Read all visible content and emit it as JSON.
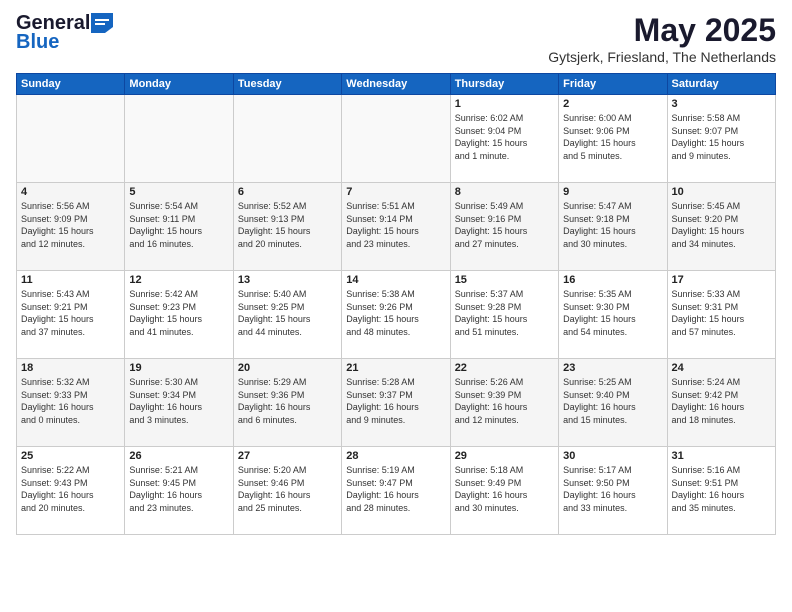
{
  "header": {
    "logo_general": "General",
    "logo_blue": "Blue",
    "month_title": "May 2025",
    "location": "Gytsjerk, Friesland, The Netherlands"
  },
  "days_of_week": [
    "Sunday",
    "Monday",
    "Tuesday",
    "Wednesday",
    "Thursday",
    "Friday",
    "Saturday"
  ],
  "weeks": [
    [
      {
        "day": "",
        "info": ""
      },
      {
        "day": "",
        "info": ""
      },
      {
        "day": "",
        "info": ""
      },
      {
        "day": "",
        "info": ""
      },
      {
        "day": "1",
        "info": "Sunrise: 6:02 AM\nSunset: 9:04 PM\nDaylight: 15 hours\nand 1 minute."
      },
      {
        "day": "2",
        "info": "Sunrise: 6:00 AM\nSunset: 9:06 PM\nDaylight: 15 hours\nand 5 minutes."
      },
      {
        "day": "3",
        "info": "Sunrise: 5:58 AM\nSunset: 9:07 PM\nDaylight: 15 hours\nand 9 minutes."
      }
    ],
    [
      {
        "day": "4",
        "info": "Sunrise: 5:56 AM\nSunset: 9:09 PM\nDaylight: 15 hours\nand 12 minutes."
      },
      {
        "day": "5",
        "info": "Sunrise: 5:54 AM\nSunset: 9:11 PM\nDaylight: 15 hours\nand 16 minutes."
      },
      {
        "day": "6",
        "info": "Sunrise: 5:52 AM\nSunset: 9:13 PM\nDaylight: 15 hours\nand 20 minutes."
      },
      {
        "day": "7",
        "info": "Sunrise: 5:51 AM\nSunset: 9:14 PM\nDaylight: 15 hours\nand 23 minutes."
      },
      {
        "day": "8",
        "info": "Sunrise: 5:49 AM\nSunset: 9:16 PM\nDaylight: 15 hours\nand 27 minutes."
      },
      {
        "day": "9",
        "info": "Sunrise: 5:47 AM\nSunset: 9:18 PM\nDaylight: 15 hours\nand 30 minutes."
      },
      {
        "day": "10",
        "info": "Sunrise: 5:45 AM\nSunset: 9:20 PM\nDaylight: 15 hours\nand 34 minutes."
      }
    ],
    [
      {
        "day": "11",
        "info": "Sunrise: 5:43 AM\nSunset: 9:21 PM\nDaylight: 15 hours\nand 37 minutes."
      },
      {
        "day": "12",
        "info": "Sunrise: 5:42 AM\nSunset: 9:23 PM\nDaylight: 15 hours\nand 41 minutes."
      },
      {
        "day": "13",
        "info": "Sunrise: 5:40 AM\nSunset: 9:25 PM\nDaylight: 15 hours\nand 44 minutes."
      },
      {
        "day": "14",
        "info": "Sunrise: 5:38 AM\nSunset: 9:26 PM\nDaylight: 15 hours\nand 48 minutes."
      },
      {
        "day": "15",
        "info": "Sunrise: 5:37 AM\nSunset: 9:28 PM\nDaylight: 15 hours\nand 51 minutes."
      },
      {
        "day": "16",
        "info": "Sunrise: 5:35 AM\nSunset: 9:30 PM\nDaylight: 15 hours\nand 54 minutes."
      },
      {
        "day": "17",
        "info": "Sunrise: 5:33 AM\nSunset: 9:31 PM\nDaylight: 15 hours\nand 57 minutes."
      }
    ],
    [
      {
        "day": "18",
        "info": "Sunrise: 5:32 AM\nSunset: 9:33 PM\nDaylight: 16 hours\nand 0 minutes."
      },
      {
        "day": "19",
        "info": "Sunrise: 5:30 AM\nSunset: 9:34 PM\nDaylight: 16 hours\nand 3 minutes."
      },
      {
        "day": "20",
        "info": "Sunrise: 5:29 AM\nSunset: 9:36 PM\nDaylight: 16 hours\nand 6 minutes."
      },
      {
        "day": "21",
        "info": "Sunrise: 5:28 AM\nSunset: 9:37 PM\nDaylight: 16 hours\nand 9 minutes."
      },
      {
        "day": "22",
        "info": "Sunrise: 5:26 AM\nSunset: 9:39 PM\nDaylight: 16 hours\nand 12 minutes."
      },
      {
        "day": "23",
        "info": "Sunrise: 5:25 AM\nSunset: 9:40 PM\nDaylight: 16 hours\nand 15 minutes."
      },
      {
        "day": "24",
        "info": "Sunrise: 5:24 AM\nSunset: 9:42 PM\nDaylight: 16 hours\nand 18 minutes."
      }
    ],
    [
      {
        "day": "25",
        "info": "Sunrise: 5:22 AM\nSunset: 9:43 PM\nDaylight: 16 hours\nand 20 minutes."
      },
      {
        "day": "26",
        "info": "Sunrise: 5:21 AM\nSunset: 9:45 PM\nDaylight: 16 hours\nand 23 minutes."
      },
      {
        "day": "27",
        "info": "Sunrise: 5:20 AM\nSunset: 9:46 PM\nDaylight: 16 hours\nand 25 minutes."
      },
      {
        "day": "28",
        "info": "Sunrise: 5:19 AM\nSunset: 9:47 PM\nDaylight: 16 hours\nand 28 minutes."
      },
      {
        "day": "29",
        "info": "Sunrise: 5:18 AM\nSunset: 9:49 PM\nDaylight: 16 hours\nand 30 minutes."
      },
      {
        "day": "30",
        "info": "Sunrise: 5:17 AM\nSunset: 9:50 PM\nDaylight: 16 hours\nand 33 minutes."
      },
      {
        "day": "31",
        "info": "Sunrise: 5:16 AM\nSunset: 9:51 PM\nDaylight: 16 hours\nand 35 minutes."
      }
    ]
  ]
}
